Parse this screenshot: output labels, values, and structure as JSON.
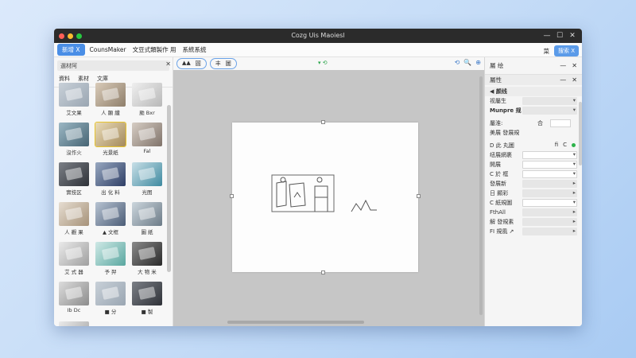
{
  "window": {
    "title": "Cozg Uis Maoiesl"
  },
  "menubar": {
    "primary_button": "新增 X",
    "items": [
      "CounsMaker",
      "文豆式類製作 用",
      "系統系统"
    ],
    "right_label": "菜",
    "search_label": "搜索 X"
  },
  "left_panel": {
    "search_placeholder": "選材阿",
    "tabs": [
      "資料",
      "素材",
      "文庫"
    ],
    "thumbnails": [
      {
        "caption": "艾文果",
        "style": "t1"
      },
      {
        "caption": "人 顯 纖",
        "style": "t2"
      },
      {
        "caption": "颱 Bxr",
        "style": "t3"
      },
      {
        "caption": "沒作火",
        "style": "t4"
      },
      {
        "caption": "光景紙",
        "style": "t5",
        "selected": true
      },
      {
        "caption": "Fal",
        "style": "t6"
      },
      {
        "caption": "實技区",
        "style": "t7"
      },
      {
        "caption": "出 化 料",
        "style": "t8"
      },
      {
        "caption": "光图",
        "style": "t9"
      },
      {
        "caption": "人 觀 果",
        "style": "t10"
      },
      {
        "caption": "▲ 文框",
        "style": "t11"
      },
      {
        "caption": "圖 紙",
        "style": "t12"
      },
      {
        "caption": "艾 式 器",
        "style": "t13"
      },
      {
        "caption": "予 羿",
        "style": "t14"
      },
      {
        "caption": "大 物 米",
        "style": "t15"
      },
      {
        "caption": "Ib Dc",
        "style": "t16"
      },
      {
        "caption": "■ 分",
        "style": "t1"
      },
      {
        "caption": "■ 製",
        "style": "t7"
      },
      {
        "caption": "",
        "style": "t13"
      }
    ]
  },
  "canvas_toolbar": {
    "group1": [
      "▲▲",
      "圓"
    ],
    "group2": [
      "丰",
      "圖"
    ],
    "mid_icon": "▾ ⟲",
    "right_icons": [
      "⟲",
      "🔍",
      "⊕"
    ]
  },
  "right_panel": {
    "header": "屬 绘",
    "sub": "屬性",
    "rows": [
      {
        "label": "◀ 颜线",
        "type": "section-light"
      },
      {
        "label": "视屬生",
        "field": "gray",
        "arrow": "▾"
      },
      {
        "label": "Munpre 规 裝",
        "field": "gray",
        "arrow": "▾",
        "highlight": true
      },
      {
        "label": "屬淮:",
        "mini": true
      },
      {
        "label": "美展 發展規",
        "type": "plain"
      },
      {
        "label": "D 此 丸圖",
        "tiny": true
      },
      {
        "label": "纽展網裹",
        "field": "white",
        "arrow": "▾"
      },
      {
        "label": "開展",
        "field": "white",
        "arrow": "▾"
      },
      {
        "label": "C 於 框",
        "field": "white",
        "arrow": "▾"
      },
      {
        "label": "發展新",
        "field": "gray",
        "arrow": "▸"
      },
      {
        "label": "日 顯彩",
        "field": "gray",
        "arrow": "▸"
      },
      {
        "label": "C 紙規圖",
        "field": "white",
        "arrow": "▾"
      },
      {
        "label": "FthAll",
        "field": "gray",
        "arrow": "▸"
      },
      {
        "label": "解 發規素",
        "field": "gray",
        "arrow": "▸"
      },
      {
        "label": "FI 規風 ↗",
        "field": "gray",
        "arrow": "▸"
      }
    ],
    "tiny_icons": [
      "fi",
      "C"
    ],
    "mini_icon": "合"
  }
}
